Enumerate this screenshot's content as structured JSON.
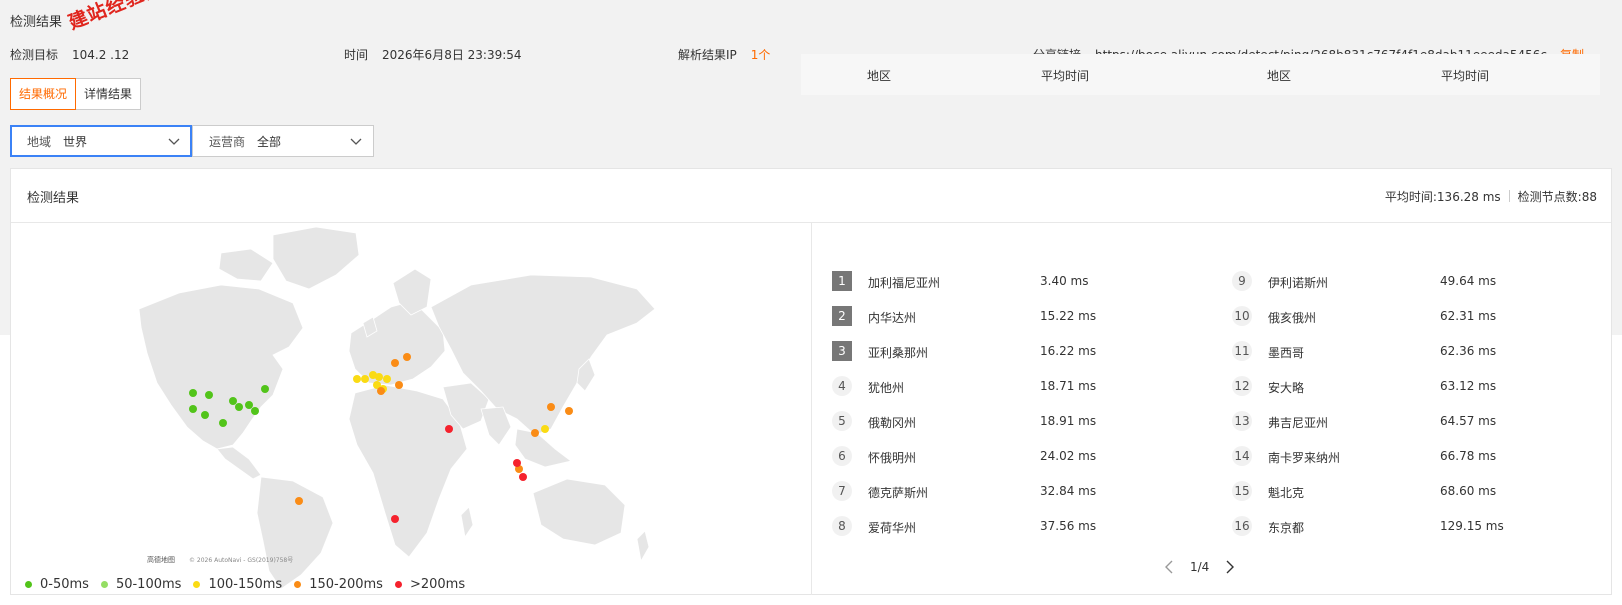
{
  "page": {
    "title": "检测结果"
  },
  "meta": {
    "target_label": "检测目标",
    "target_value": "104.2    .12",
    "time_label": "时间",
    "time_value": "2026年6月8日 23:39:54",
    "ip_label": "解析结果IP",
    "ip_count": "1个",
    "share_label": "分享链接",
    "share_url": "https://boce.aliyun.com/detect/ping/268b831c767f4f1e8dab11eeeda5456c",
    "copy_label": "复制"
  },
  "watermark": "建站经验分享-www.w",
  "tabs": [
    {
      "label": "结果概况",
      "active": true
    },
    {
      "label": "详情结果",
      "active": false
    }
  ],
  "filters": {
    "region": {
      "label": "地域",
      "value": "世界"
    },
    "isp": {
      "label": "运营商",
      "value": "全部"
    }
  },
  "panel": {
    "title": "检测结果",
    "avg_time": "平均时间:136.28 ms",
    "node_count": "检测节点数:88"
  },
  "map": {
    "attribution": "© 2026 AutoNavi - GS(2019)758号",
    "brand": "高德地图",
    "colors": {
      "land": "#e6e6e6",
      "green_dark": "#52c41a",
      "green_light": "#95de64",
      "yellow": "#fadb14",
      "orange": "#fa8c16",
      "red": "#f5222d"
    }
  },
  "legend": [
    {
      "label": "0-50ms",
      "color": "#52c41a"
    },
    {
      "label": "50-100ms",
      "color": "#95de64"
    },
    {
      "label": "100-150ms",
      "color": "#fadb14"
    },
    {
      "label": "150-200ms",
      "color": "#fa8c16"
    },
    {
      "label": ">200ms",
      "color": "#f5222d"
    }
  ],
  "table": {
    "headers": {
      "region": "地区",
      "avg": "平均时间"
    },
    "rows": [
      {
        "rank": "1",
        "region": "加利福尼亚州",
        "avg": "3.40 ms"
      },
      {
        "rank": "2",
        "region": "内华达州",
        "avg": "15.22 ms"
      },
      {
        "rank": "3",
        "region": "亚利桑那州",
        "avg": "16.22 ms"
      },
      {
        "rank": "4",
        "region": "犹他州",
        "avg": "18.71 ms"
      },
      {
        "rank": "5",
        "region": "俄勒冈州",
        "avg": "18.91 ms"
      },
      {
        "rank": "6",
        "region": "怀俄明州",
        "avg": "24.02 ms"
      },
      {
        "rank": "7",
        "region": "德克萨斯州",
        "avg": "32.84 ms"
      },
      {
        "rank": "8",
        "region": "爱荷华州",
        "avg": "37.56 ms"
      },
      {
        "rank": "9",
        "region": "伊利诺斯州",
        "avg": "49.64 ms"
      },
      {
        "rank": "10",
        "region": "俄亥俄州",
        "avg": "62.31 ms"
      },
      {
        "rank": "11",
        "region": "墨西哥",
        "avg": "62.36 ms"
      },
      {
        "rank": "12",
        "region": "安大略",
        "avg": "63.12 ms"
      },
      {
        "rank": "13",
        "region": "弗吉尼亚州",
        "avg": "64.57 ms"
      },
      {
        "rank": "14",
        "region": "南卡罗来纳州",
        "avg": "66.78 ms"
      },
      {
        "rank": "15",
        "region": "魁北克",
        "avg": "68.60 ms"
      },
      {
        "rank": "16",
        "region": "东京都",
        "avg": "129.15 ms"
      }
    ]
  },
  "pager": {
    "text": "1/4"
  }
}
